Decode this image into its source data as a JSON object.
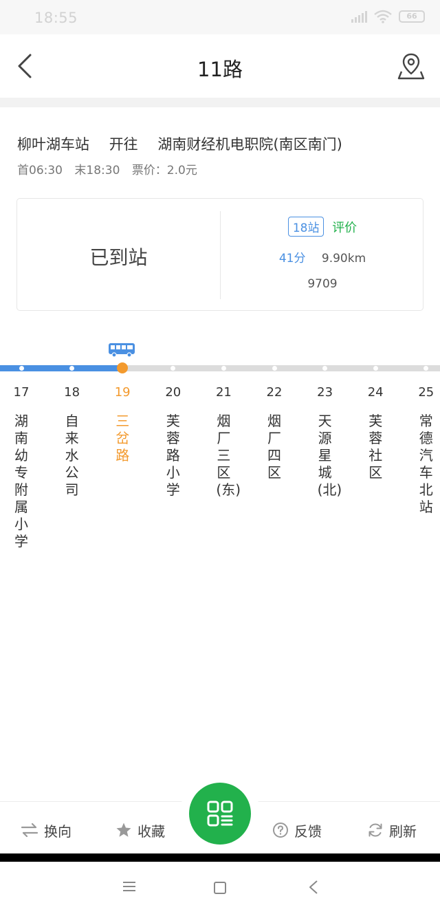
{
  "status_bar": {
    "time": "18:55",
    "battery": "66"
  },
  "header": {
    "title": "11路"
  },
  "route": {
    "from": "柳叶湖车站",
    "direction_label": "开往",
    "to": "湖南财经机电职院(南区南门)",
    "first_bus": "首06:30",
    "last_bus": "末18:30",
    "fare": "票价：2.0元"
  },
  "arrival": {
    "status": "已到站",
    "stops": "18站",
    "rate_label": "评价",
    "minutes": "41分",
    "distance": "9.90km",
    "vehicle": "9709"
  },
  "timeline": {
    "current_stop": "19",
    "stops": [
      {
        "num": "17",
        "name": "湖南幼专附属小学"
      },
      {
        "num": "18",
        "name": "自来水公司"
      },
      {
        "num": "19",
        "name": "三岔路"
      },
      {
        "num": "20",
        "name": "芙蓉路小学"
      },
      {
        "num": "21",
        "name": "烟厂三区(东)"
      },
      {
        "num": "22",
        "name": "烟厂四区"
      },
      {
        "num": "23",
        "name": "天源星城(北)"
      },
      {
        "num": "24",
        "name": "芙蓉社区"
      },
      {
        "num": "25",
        "name": "常德汽车北站"
      }
    ]
  },
  "toolbar": {
    "reverse": "换向",
    "favorite": "收藏",
    "feedback": "反馈",
    "refresh": "刷新"
  },
  "colors": {
    "accent_blue": "#4a90e2",
    "accent_green": "#22b14c",
    "current_orange": "#f39a2e"
  }
}
